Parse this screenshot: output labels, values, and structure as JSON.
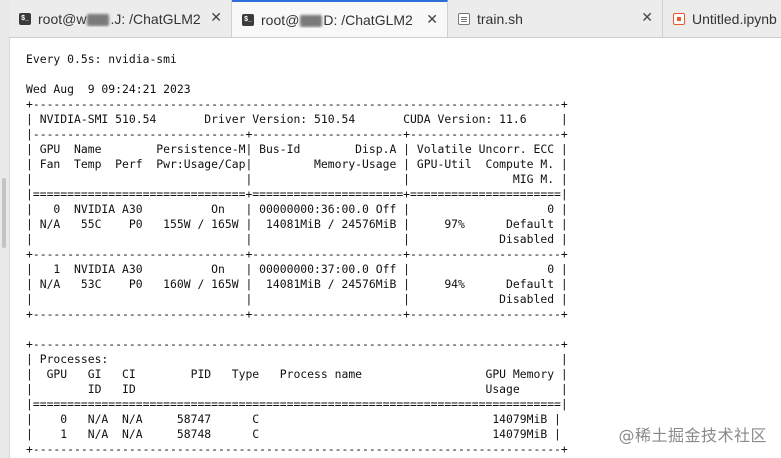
{
  "tabs": [
    {
      "icon": "terminal-icon",
      "prefix": "root@w",
      "suffix": ".J: /ChatGLM2",
      "active": false
    },
    {
      "icon": "terminal-icon",
      "prefix": "root@",
      "suffix": "D: /ChatGLM2",
      "active": true
    },
    {
      "icon": "file-icon",
      "label": "train.sh",
      "active": false
    },
    {
      "icon": "notebook-icon",
      "label": "Untitled.ipynb",
      "active": false
    }
  ],
  "close_glyph": "✕",
  "terminal_output": "Every 0.5s: nvidia-smi\n\nWed Aug  9 09:24:21 2023\n+-----------------------------------------------------------------------------+\n| NVIDIA-SMI 510.54       Driver Version: 510.54       CUDA Version: 11.6     |\n|-------------------------------+----------------------+----------------------+\n| GPU  Name        Persistence-M| Bus-Id        Disp.A | Volatile Uncorr. ECC |\n| Fan  Temp  Perf  Pwr:Usage/Cap|         Memory-Usage | GPU-Util  Compute M. |\n|                               |                      |               MIG M. |\n|===============================+======================+======================|\n|   0  NVIDIA A30          On   | 00000000:36:00.0 Off |                    0 |\n| N/A   55C    P0   155W / 165W |  14081MiB / 24576MiB |     97%      Default |\n|                               |                      |             Disabled |\n+-------------------------------+----------------------+----------------------+\n|   1  NVIDIA A30          On   | 00000000:37:00.0 Off |                    0 |\n| N/A   53C    P0   160W / 165W |  14081MiB / 24576MiB |     94%      Default |\n|                               |                      |             Disabled |\n+-------------------------------+----------------------+----------------------+\n\n+-----------------------------------------------------------------------------+\n| Processes:                                                                  |\n|  GPU   GI   CI        PID   Type   Process name                  GPU Memory |\n|        ID   ID                                                   Usage      |\n|=============================================================================|\n|    0   N/A  N/A     58747      C                                  14079MiB |\n|    1   N/A  N/A     58748      C                                  14079MiB |\n+-----------------------------------------------------------------------------+",
  "watermark": "@稀土掘金技术社区"
}
